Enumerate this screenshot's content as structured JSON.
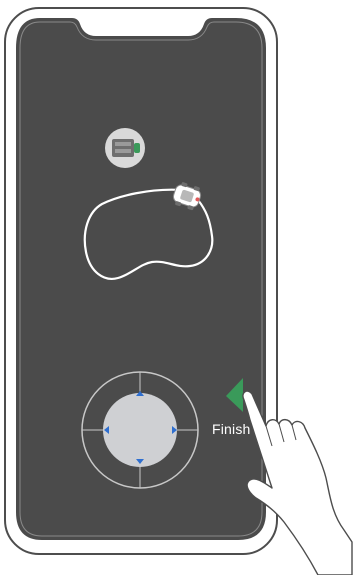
{
  "screen": {
    "phone_body_color": "#ffffff",
    "phone_outline_color": "#4d4d4d",
    "screen_color": "#4b4b4b",
    "accent_color": "#3a9a5a"
  },
  "icons": {
    "base_station": "charging-station-icon",
    "mower": "robot-mower-icon",
    "finish_arrow": "triangle-left-icon",
    "hand": "pointing-hand-icon"
  },
  "joystick": {
    "directions": [
      "up",
      "down",
      "left",
      "right"
    ]
  },
  "finish": {
    "label": "Finish"
  }
}
